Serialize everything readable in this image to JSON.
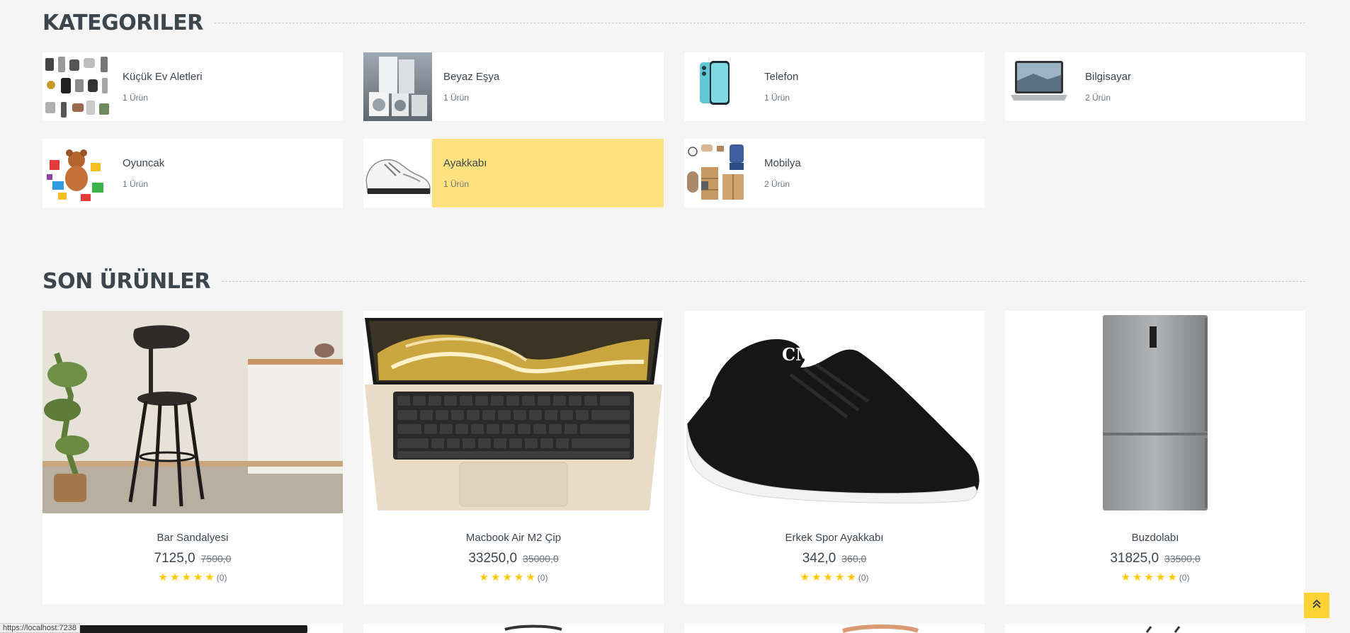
{
  "categories_title": "KATEGORILER",
  "latest_title": "SON ÜRÜNLER",
  "categories": [
    {
      "name": "Küçük Ev Aletleri",
      "count": "1 Ürün"
    },
    {
      "name": "Beyaz Eşya",
      "count": "1 Ürün"
    },
    {
      "name": "Telefon",
      "count": "1 Ürün"
    },
    {
      "name": "Bilgisayar",
      "count": "2 Ürün"
    },
    {
      "name": "Oyuncak",
      "count": "1 Ürün"
    },
    {
      "name": "Ayakkabı",
      "count": "1 Ürün"
    },
    {
      "name": "Mobilya",
      "count": "2 Ürün"
    }
  ],
  "products": [
    {
      "name": "Bar Sandalyesi",
      "price": "7125,0",
      "old_price": "7500,0",
      "rating": 5,
      "reviews": "(0)"
    },
    {
      "name": "Macbook Air M2 Çip",
      "price": "33250,0",
      "old_price": "35000,0",
      "rating": 5,
      "reviews": "(0)"
    },
    {
      "name": "Erkek Spor Ayakkabı",
      "price": "342,0",
      "old_price": "360,0",
      "rating": 5,
      "reviews": "(0)"
    },
    {
      "name": "Buzdolabı",
      "price": "31825,0",
      "old_price": "33500,0",
      "rating": 5,
      "reviews": "(0)"
    }
  ],
  "status_url": "https://localhost:7238",
  "colors": {
    "accent": "#ffd333",
    "active_category": "#ffe280",
    "star": "#ffc800"
  },
  "icons": {
    "back_to_top": "double-chevron-up-icon",
    "star": "star-icon"
  }
}
